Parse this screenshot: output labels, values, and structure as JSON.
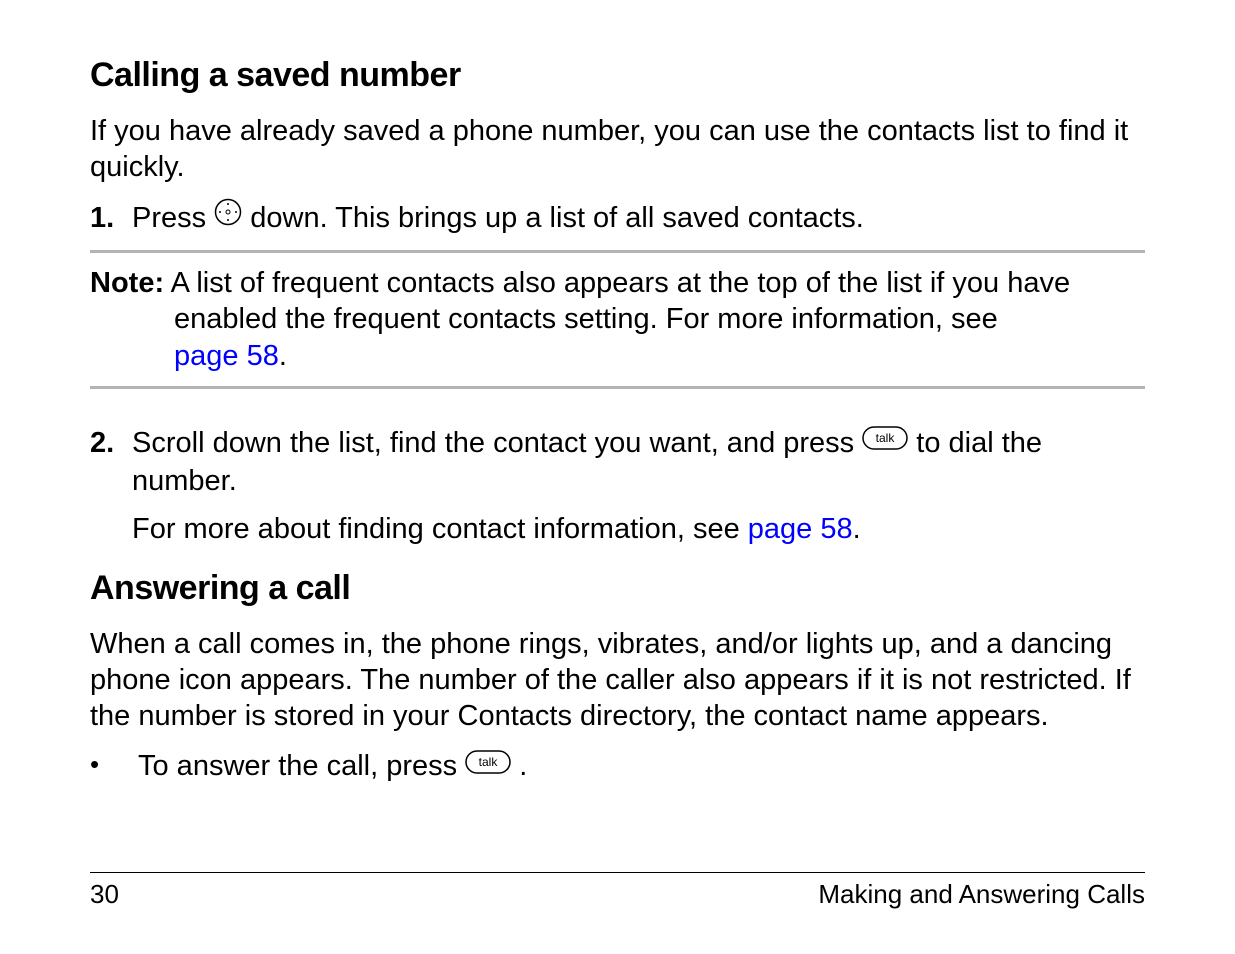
{
  "section1": {
    "heading": "Calling a saved number",
    "intro": "If you have already saved a phone number, you can use the contacts list to find it quickly.",
    "step1": {
      "num": "1.",
      "before_icon": "Press ",
      "after_icon": " down. This brings up a list of all saved contacts."
    },
    "note": {
      "label": "Note:",
      "line1_after_label": " A list of frequent contacts also appears at the top of the list if you have",
      "line2": "enabled the frequent contacts setting. For more information, see ",
      "link": "page 58",
      "period": "."
    },
    "step2": {
      "num": "2.",
      "before_icon": "Scroll down the list, find the contact you want, and press ",
      "after_icon": " to dial the number.",
      "more_before_link": "For more about finding contact information, see ",
      "more_link": "page 58",
      "more_period": "."
    }
  },
  "section2": {
    "heading": "Answering a call",
    "intro": "When a call comes in, the phone rings, vibrates, and/or lights up, and a dancing phone icon appears. The number of the caller also appears if it is not restricted. If the number is stored in your Contacts directory, the contact name appears.",
    "bullet1": {
      "before_icon": "To answer the call, press ",
      "after_icon": "."
    }
  },
  "footer": {
    "page_number": "30",
    "chapter": "Making and Answering Calls"
  },
  "icons": {
    "nav_key_label": "nav-key-icon",
    "talk_key_text": "talk"
  }
}
